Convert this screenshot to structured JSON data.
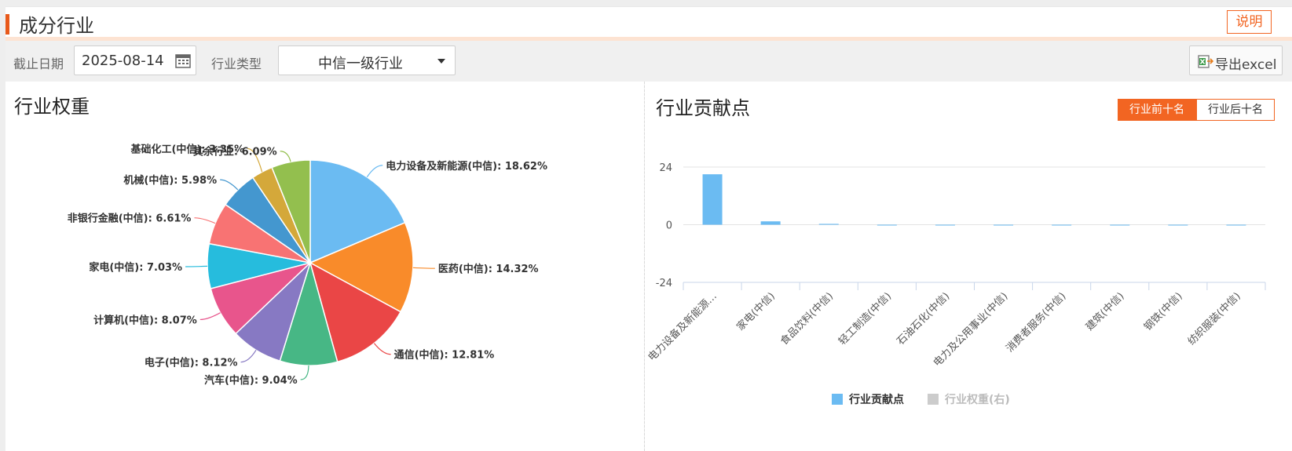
{
  "header": {
    "title": "成分行业",
    "help_label": "说明"
  },
  "toolbar": {
    "date_label": "截止日期",
    "date_value": "2025-08-14",
    "type_label": "行业类型",
    "type_value": "中信一级行业",
    "export_label": "导出excel"
  },
  "left_panel": {
    "title": "行业权重"
  },
  "right_panel": {
    "title": "行业贡献点",
    "tabs": [
      "行业前十名",
      "行业后十名"
    ],
    "active_tab": 0
  },
  "chart_data": [
    {
      "type": "pie",
      "title": "行业权重",
      "slices": [
        {
          "label": "电力设备及新能源(中信)",
          "value": 18.62,
          "color": "#6bbbf2"
        },
        {
          "label": "医药(中信)",
          "value": 14.32,
          "color": "#f98b2a"
        },
        {
          "label": "通信(中信)",
          "value": 12.81,
          "color": "#ea4646"
        },
        {
          "label": "汽车(中信)",
          "value": 9.04,
          "color": "#47b785"
        },
        {
          "label": "电子(中信)",
          "value": 8.12,
          "color": "#8779c3"
        },
        {
          "label": "计算机(中信)",
          "value": 8.07,
          "color": "#e8558c"
        },
        {
          "label": "家电(中信)",
          "value": 7.03,
          "color": "#26bcdd"
        },
        {
          "label": "非银行金融(中信)",
          "value": 6.61,
          "color": "#f87373"
        },
        {
          "label": "机械(中信)",
          "value": 5.98,
          "color": "#4497cf"
        },
        {
          "label": "基础化工(中信)",
          "value": 3.35,
          "color": "#d4a83a"
        },
        {
          "label": "其余行业",
          "value": 6.09,
          "color": "#93bf4e"
        }
      ],
      "label_format": "{label}: {value}%"
    },
    {
      "type": "bar",
      "title": "行业贡献点",
      "categories": [
        "电力设备及新能源…",
        "家电(中信)",
        "食品饮料(中信)",
        "轻工制造(中信)",
        "石油石化(中信)",
        "电力及公用事业(中信)",
        "消费者服务(中信)",
        "建筑(中信)",
        "钢铁(中信)",
        "纺织服装(中信)"
      ],
      "series": [
        {
          "name": "行业贡献点",
          "values": [
            21,
            1.4,
            0.35,
            -0.3,
            -0.3,
            -0.3,
            -0.3,
            -0.3,
            -0.3,
            -0.3
          ],
          "color": "#6bbbf2"
        }
      ],
      "legend": [
        {
          "name": "行业贡献点",
          "color": "#6bbbf2",
          "active": true
        },
        {
          "name": "行业权重(右)",
          "color": "#cccccc",
          "active": false
        }
      ],
      "y_ticks": [
        "24",
        "0",
        "-24"
      ],
      "ylim": [
        -24,
        24
      ],
      "legend_position": "bottom-center",
      "grid": true
    }
  ]
}
